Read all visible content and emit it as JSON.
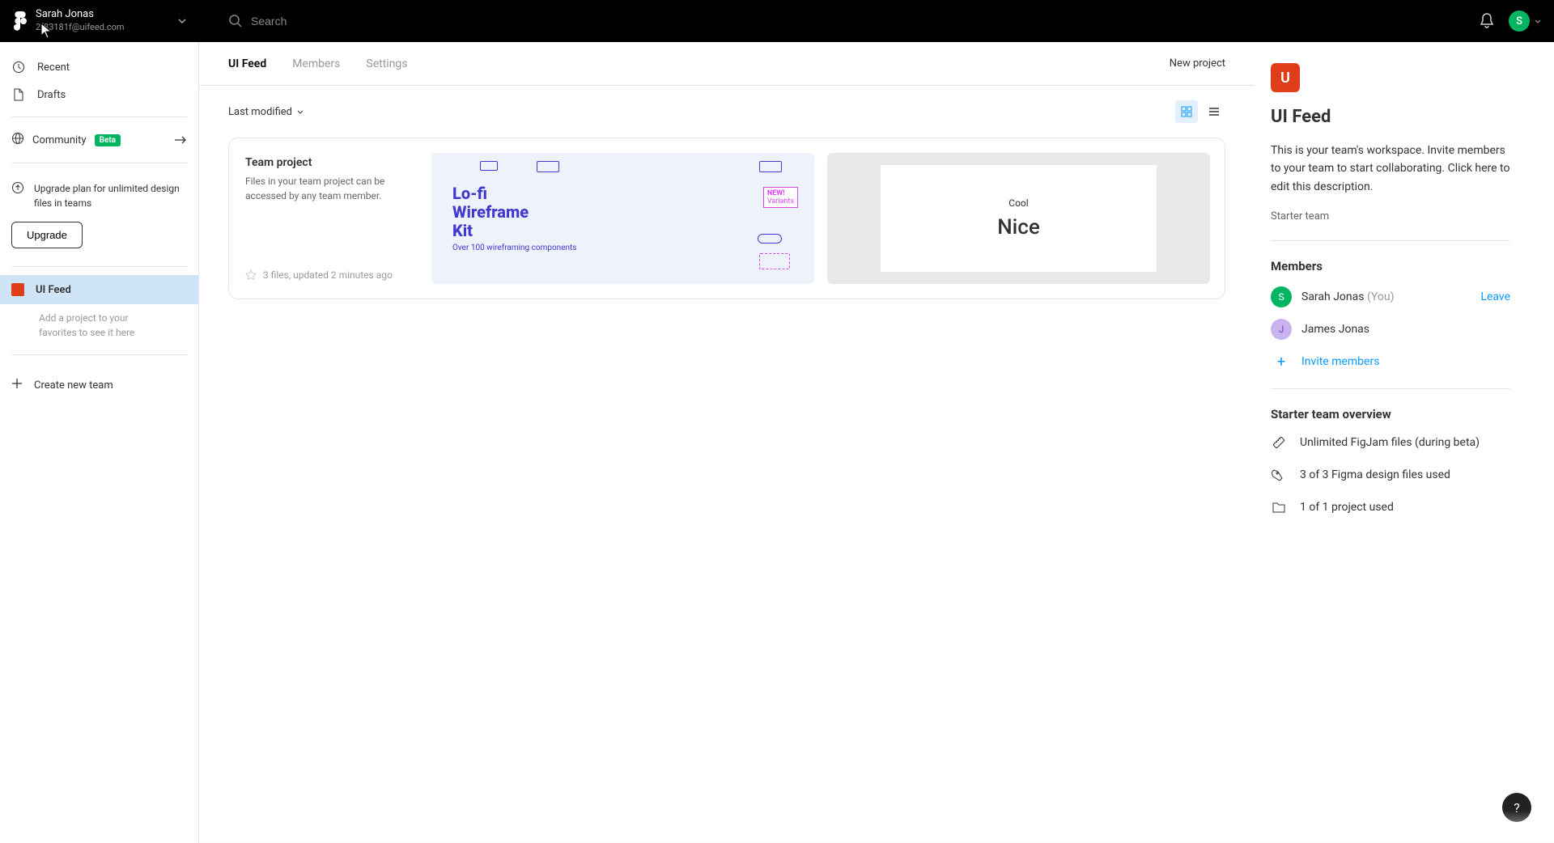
{
  "user": {
    "name": "Sarah Jonas",
    "email": "2f83181f@uifeed.com",
    "avatar_initial": "S"
  },
  "search": {
    "placeholder": "Search"
  },
  "sidebar": {
    "recent": "Recent",
    "drafts": "Drafts",
    "community": "Community",
    "beta": "Beta",
    "upgrade_text": "Upgrade plan for unlimited design files in teams",
    "upgrade_btn": "Upgrade",
    "team_name": "UI Feed",
    "favorites_hint": "Add a project to your favorites to see it here",
    "create_team": "Create new team"
  },
  "tabs": {
    "feed": "UI Feed",
    "members": "Members",
    "settings": "Settings",
    "new_project": "New project"
  },
  "toolbar": {
    "sort": "Last modified"
  },
  "project": {
    "title": "Team project",
    "desc": "Files in your team project can be accessed by any team member.",
    "meta": "3 files, updated 2 minutes ago",
    "thumb1_line1": "Lo-fi",
    "thumb1_line2": "Wireframe",
    "thumb1_line3": "Kit",
    "thumb1_sub": "Over 100 wireframing components",
    "thumb1_badge1": "NEW!",
    "thumb1_badge2": "Variants",
    "thumb2_cool": "Cool",
    "thumb2_nice": "Nice"
  },
  "panel": {
    "icon_letter": "U",
    "title": "UI Feed",
    "desc": "This is your team's workspace. Invite members to your team to start collaborating. Click here to edit this description.",
    "plan": "Starter team",
    "members_title": "Members",
    "member1_initial": "S",
    "member1_name": "Sarah Jonas",
    "member1_you": "(You)",
    "leave": "Leave",
    "member2_initial": "J",
    "member2_name": "James Jonas",
    "invite": "Invite members",
    "overview_title": "Starter team overview",
    "overview1": "Unlimited FigJam files (during beta)",
    "overview2": "3 of 3 Figma design files used",
    "overview3": "1 of 1 project used"
  },
  "help": "?"
}
